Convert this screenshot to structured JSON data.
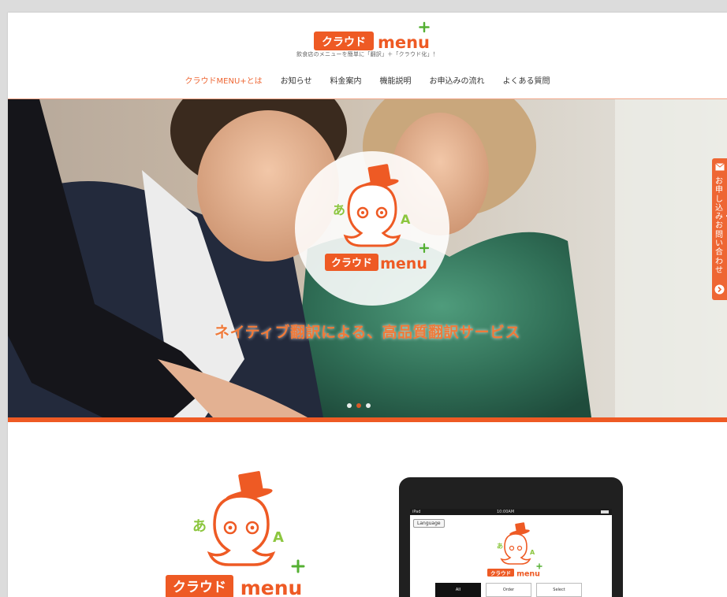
{
  "header": {
    "logo_text_kana": "クラウド",
    "logo_text_latin": "menu",
    "tagline": "飲食店のメニューを簡単に「翻訳」＋「クラウド化」！"
  },
  "nav": {
    "items": [
      {
        "label": "クラウドMENU+とは",
        "active": true
      },
      {
        "label": "お知らせ",
        "active": false
      },
      {
        "label": "料金案内",
        "active": false
      },
      {
        "label": "機能説明",
        "active": false
      },
      {
        "label": "お申込みの流れ",
        "active": false
      },
      {
        "label": "よくある質問",
        "active": false
      }
    ]
  },
  "hero": {
    "title": "ネイティブ翻訳による、高品質翻訳サービス",
    "slide_count": 3,
    "active_slide": 2
  },
  "side_tab": {
    "label": "お申し込み・お問い合わせ"
  },
  "ipad": {
    "status_left": "iPad",
    "status_center": "10:00AM",
    "language_button": "Language",
    "tabs": [
      {
        "label": "All",
        "selected": true
      },
      {
        "label": "Order",
        "selected": false
      },
      {
        "label": "Select",
        "selected": false
      }
    ]
  },
  "colors": {
    "accent": "#ee5a24",
    "accent_light": "#f07a3a",
    "mascot_green": "#8cc63f"
  }
}
